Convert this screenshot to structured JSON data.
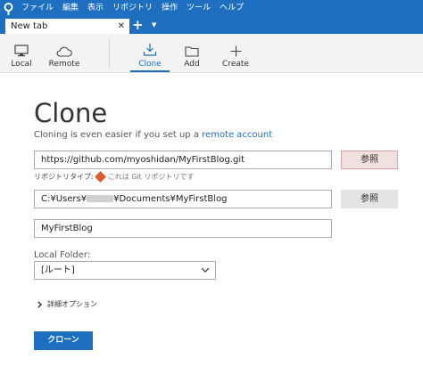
{
  "menu": {
    "items": [
      "ファイル",
      "編集",
      "表示",
      "リポジトリ",
      "操作",
      "ツール",
      "ヘルプ"
    ]
  },
  "tabs": {
    "active_label": "New tab",
    "close_glyph": "✕",
    "add_glyph": "+",
    "menu_glyph": "▼"
  },
  "toolbar": {
    "local": "Local",
    "remote": "Remote",
    "clone": "Clone",
    "add": "Add",
    "create": "Create"
  },
  "page": {
    "title": "Clone",
    "subtitle_text": "Cloning is even easier if you set up a",
    "subtitle_link": "remote account"
  },
  "form": {
    "url_value": "https://github.com/myoshidan/MyFirstBlog.git",
    "browse_label": "参照",
    "repo_type_label": "リポジトリタイプ:",
    "repo_type_value": "これは Git リポジトリです",
    "path_prefix": "C:¥Users¥",
    "path_suffix": "¥Documents¥MyFirstBlog",
    "name_value": "MyFirstBlog",
    "local_folder_label": "Local Folder:",
    "local_folder_value": "[ルート]",
    "advanced_label": "詳細オプション",
    "clone_button": "クローン"
  },
  "colors": {
    "accent": "#1e6fc0",
    "git": "#e0592b"
  }
}
